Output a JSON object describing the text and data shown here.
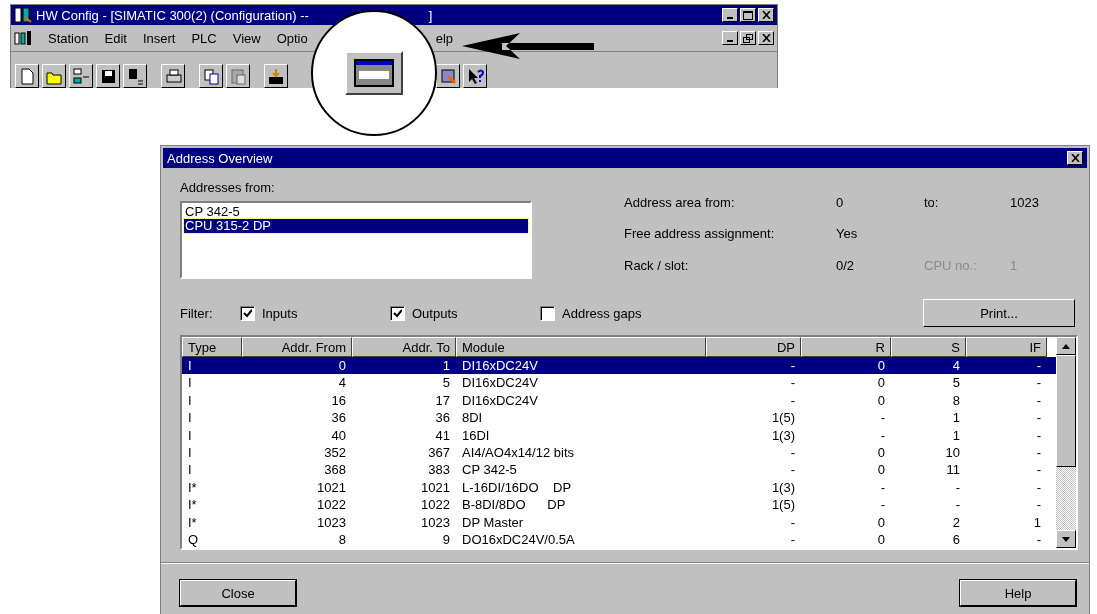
{
  "hw_window": {
    "title": "HW Config - [SIMATIC 300(2) (Configuration) --",
    "title_end": "]",
    "menu": [
      "Station",
      "Edit",
      "Insert",
      "PLC",
      "View",
      "Optio",
      "elp"
    ]
  },
  "dialog": {
    "title": "Address Overview",
    "addresses_label": "Addresses from:",
    "addresses": [
      {
        "label": "CP 342-5",
        "selected": false
      },
      {
        "label": "CPU 315-2 DP",
        "selected": true
      }
    ],
    "info": [
      {
        "label": "Address area from:",
        "value": "0",
        "extra_label": "to:",
        "extra_value": "1023",
        "extra_disabled": false
      },
      {
        "label": "Free address assignment:",
        "value": "Yes"
      },
      {
        "label": "Rack / slot:",
        "value": "0/2",
        "extra_label": "CPU no.:",
        "extra_value": "1",
        "extra_disabled": true
      }
    ],
    "filter_label": "Filter:",
    "filters": [
      {
        "label": "Inputs",
        "checked": true
      },
      {
        "label": "Outputs",
        "checked": true
      },
      {
        "label": "Address gaps",
        "checked": false
      }
    ],
    "print_button": "Print...",
    "table": {
      "columns": [
        "Type",
        "Addr. From",
        "Addr. To",
        "Module",
        "DP",
        "R",
        "S",
        "IF"
      ],
      "rows": [
        {
          "cells": [
            "I",
            "0",
            "1",
            "DI16xDC24V",
            "-",
            "0",
            "4",
            "-"
          ],
          "selected": true
        },
        {
          "cells": [
            "I",
            "4",
            "5",
            "DI16xDC24V",
            "-",
            "0",
            "5",
            "-"
          ],
          "selected": false
        },
        {
          "cells": [
            "I",
            "16",
            "17",
            "DI16xDC24V",
            "-",
            "0",
            "8",
            "-"
          ],
          "selected": false
        },
        {
          "cells": [
            "I",
            "36",
            "36",
            "8DI",
            "1(5)",
            "-",
            "1",
            "-"
          ],
          "selected": false
        },
        {
          "cells": [
            "I",
            "40",
            "41",
            "16DI",
            "1(3)",
            "-",
            "1",
            "-"
          ],
          "selected": false
        },
        {
          "cells": [
            "I",
            "352",
            "367",
            "AI4/AO4x14/12 bits",
            "-",
            "0",
            "10",
            "-"
          ],
          "selected": false
        },
        {
          "cells": [
            "I",
            "368",
            "383",
            "CP 342-5",
            "-",
            "0",
            "11",
            "-"
          ],
          "selected": false
        },
        {
          "cells": [
            "I*",
            "1021",
            "1021",
            "L-16DI/16DO    DP",
            "1(3)",
            "-",
            "-",
            "-"
          ],
          "selected": false
        },
        {
          "cells": [
            "I*",
            "1022",
            "1022",
            "B-8DI/8DO      DP",
            "1(5)",
            "-",
            "-",
            "-"
          ],
          "selected": false
        },
        {
          "cells": [
            "I*",
            "1023",
            "1023",
            "DP Master",
            "-",
            "0",
            "2",
            "1"
          ],
          "selected": false
        },
        {
          "cells": [
            "Q",
            "8",
            "9",
            "DO16xDC24V/0.5A",
            "-",
            "0",
            "6",
            "-"
          ],
          "selected": false
        }
      ]
    },
    "buttons": [
      "Close",
      "Help"
    ]
  }
}
